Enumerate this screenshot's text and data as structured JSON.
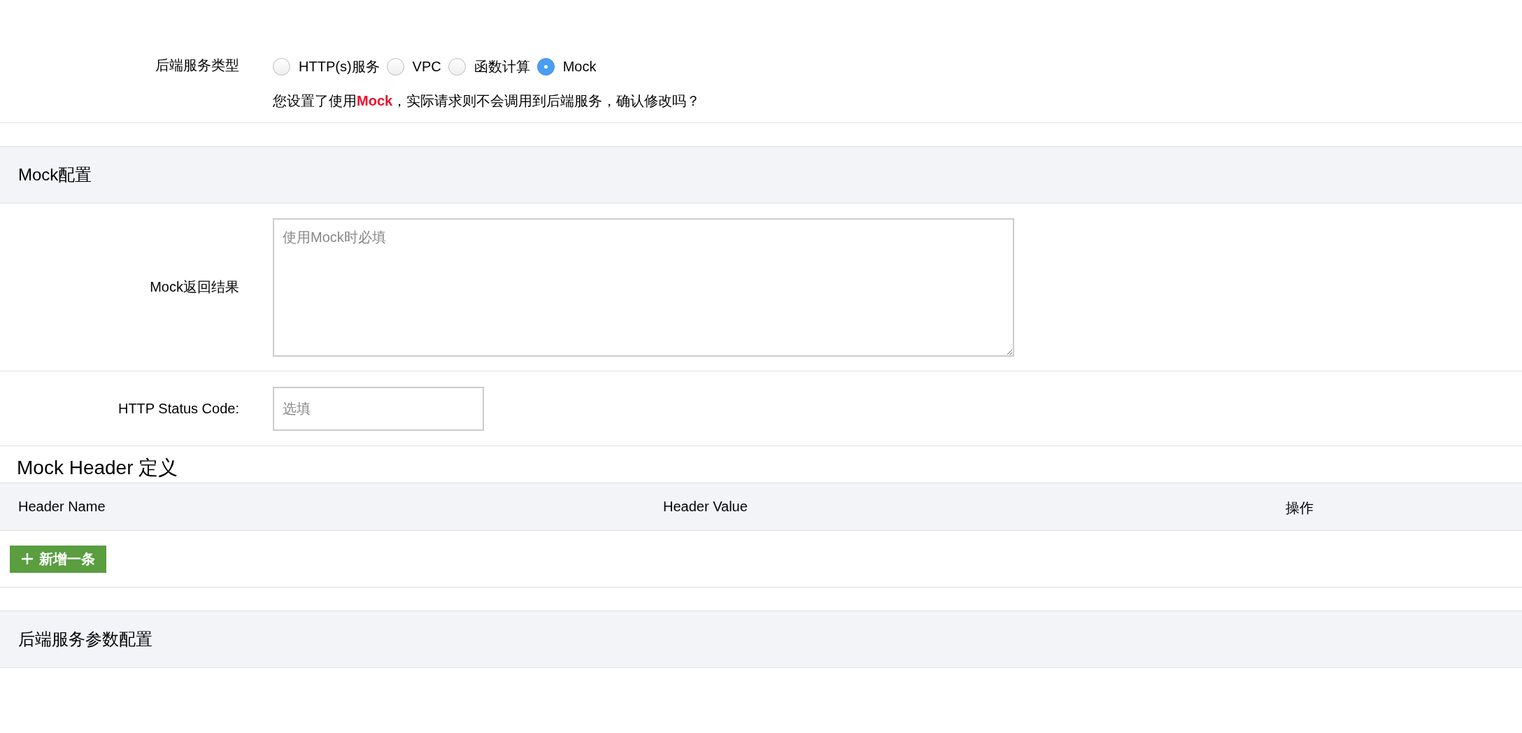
{
  "backend_type": {
    "label": "后端服务类型",
    "options": [
      {
        "label": "HTTP(s)服务",
        "selected": false
      },
      {
        "label": "VPC",
        "selected": false
      },
      {
        "label": "函数计算",
        "selected": false
      },
      {
        "label": "Mock",
        "selected": true
      }
    ],
    "hint": "您设置了使用**Mock**，实际请求则不会调用到后端服务，确认修改吗？"
  },
  "mock_section": {
    "title": "Mock配置",
    "result": {
      "label": "Mock返回结果",
      "placeholder": "使用Mock时必填"
    },
    "status_code": {
      "label": "HTTP Status Code:",
      "placeholder": "选填"
    }
  },
  "header_section": {
    "title": "Mock Header 定义",
    "columns": [
      "Header Name",
      "Header Value",
      "操作"
    ],
    "add_button": "新增一条"
  },
  "backend_params_section": {
    "title": "后端服务参数配置"
  }
}
